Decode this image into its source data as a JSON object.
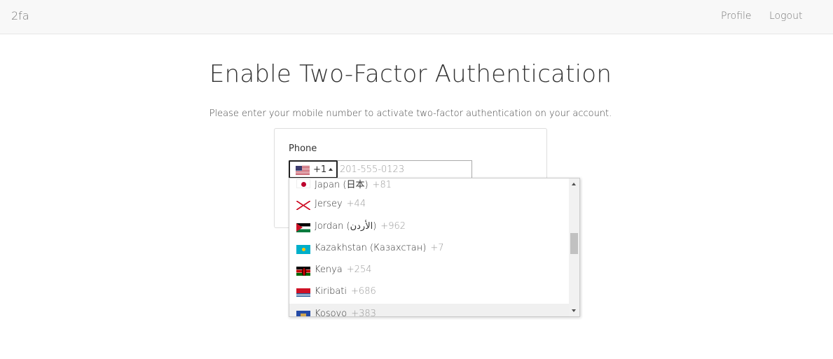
{
  "navbar": {
    "brand": "2fa",
    "links": [
      {
        "label": "Profile"
      },
      {
        "label": "Logout"
      }
    ]
  },
  "main": {
    "title": "Enable Two-Factor Authentication",
    "subtitle": "Please enter your mobile number to activate two-factor authentication on your account."
  },
  "phone_field": {
    "label": "Phone",
    "selected_country_flag": "us-flag",
    "selected_dial_code": "+1",
    "placeholder": "201-555-0123",
    "value": ""
  },
  "country_dropdown": {
    "open": true,
    "highlighted_index": 6,
    "countries": [
      {
        "name": "Japan (日本)",
        "dial_code": "+81",
        "flag": "jp-flag"
      },
      {
        "name": "Jersey",
        "dial_code": "+44",
        "flag": "je-flag"
      },
      {
        "name": "Jordan (الأردن)",
        "dial_code": "+962",
        "flag": "jo-flag"
      },
      {
        "name": "Kazakhstan (Казахстан)",
        "dial_code": "+7",
        "flag": "kz-flag"
      },
      {
        "name": "Kenya",
        "dial_code": "+254",
        "flag": "ke-flag"
      },
      {
        "name": "Kiribati",
        "dial_code": "+686",
        "flag": "ki-flag"
      },
      {
        "name": "Kosovo",
        "dial_code": "+383",
        "flag": "xk-flag"
      }
    ]
  }
}
